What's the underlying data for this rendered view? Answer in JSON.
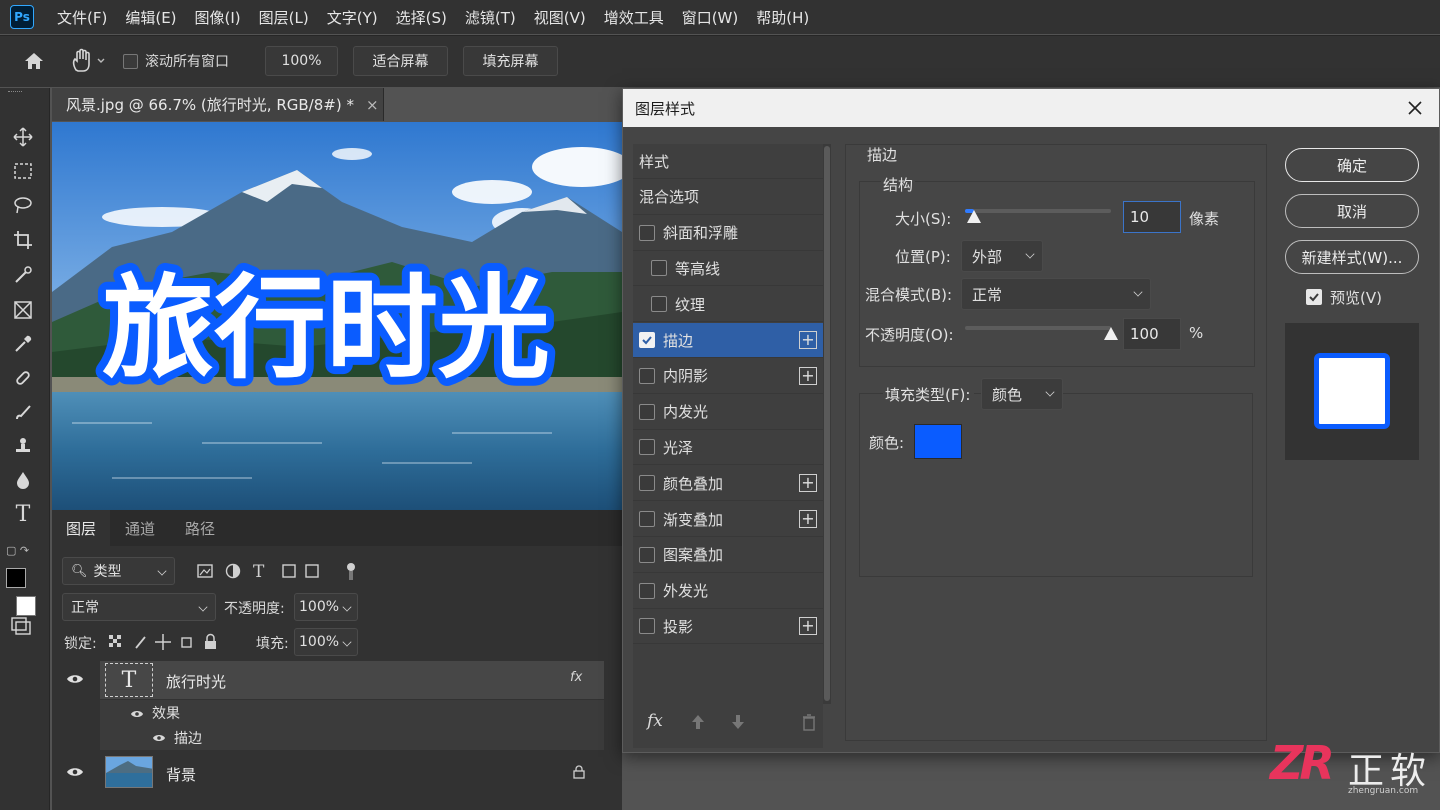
{
  "app": {
    "logo": "Ps"
  },
  "menu": [
    "文件(F)",
    "编辑(E)",
    "图像(I)",
    "图层(L)",
    "文字(Y)",
    "选择(S)",
    "滤镜(T)",
    "视图(V)",
    "增效工具",
    "窗口(W)",
    "帮助(H)"
  ],
  "options_bar": {
    "scroll_all_label": "滚动所有窗口",
    "zoom_value": "100%",
    "fit_screen": "适合屏幕",
    "fill_screen": "填充屏幕"
  },
  "document": {
    "tab_title": "风景.jpg @ 66.7% (旅行时光, RGB/8#) *",
    "canvas_text": "旅行时光"
  },
  "layers_panel": {
    "tabs": [
      "图层",
      "通道",
      "路径"
    ],
    "filter_label": "类型",
    "blend_mode": "正常",
    "opacity_label": "不透明度:",
    "opacity_value": "100%",
    "lock_label": "锁定:",
    "fill_label": "填充:",
    "fill_value": "100%",
    "layers": [
      {
        "name": "旅行时光",
        "thumb_glyph": "T",
        "effects_label": "效果",
        "effect_items": [
          "描边"
        ]
      },
      {
        "name": "背景"
      }
    ]
  },
  "dialog": {
    "title": "图层样式",
    "styles": [
      {
        "label": "样式"
      },
      {
        "label": "混合选项"
      },
      {
        "label": "斜面和浮雕",
        "checked": false
      },
      {
        "label": "等高线",
        "checked": false
      },
      {
        "label": "纹理",
        "checked": false
      },
      {
        "label": "描边",
        "checked": true
      },
      {
        "label": "内阴影",
        "checked": false
      },
      {
        "label": "内发光",
        "checked": false
      },
      {
        "label": "光泽",
        "checked": false
      },
      {
        "label": "颜色叠加",
        "checked": false
      },
      {
        "label": "渐变叠加",
        "checked": false
      },
      {
        "label": "图案叠加",
        "checked": false
      },
      {
        "label": "外发光",
        "checked": false
      },
      {
        "label": "投影",
        "checked": false
      }
    ],
    "footer_fx": "fx",
    "section_title": "描边",
    "group_title": "结构",
    "size_label": "大小(S):",
    "size_value": "10",
    "size_unit": "像素",
    "size_slider_fraction": 0.06,
    "position_label": "位置(P):",
    "position_value": "外部",
    "blend_label": "混合模式(B):",
    "blend_value": "正常",
    "opacity_label": "不透明度(O):",
    "opacity_value": "100",
    "opacity_unit": "%",
    "opacity_slider_fraction": 1.0,
    "fill_type_label": "填充类型(F):",
    "fill_type_value": "颜色",
    "color_label": "颜色:",
    "stroke_color": "#0a5cff",
    "ok_button": "确定",
    "cancel_button": "取消",
    "new_style_button": "新建样式(W)...",
    "preview_label": "预览(V)",
    "preview_checked": true
  },
  "watermark": {
    "logo": "ZR",
    "brand": "正软",
    "url": "zhengruan.com"
  },
  "colors": {
    "accent_selection": "#2f5fa6",
    "stroke_blue": "#0a5cff"
  }
}
